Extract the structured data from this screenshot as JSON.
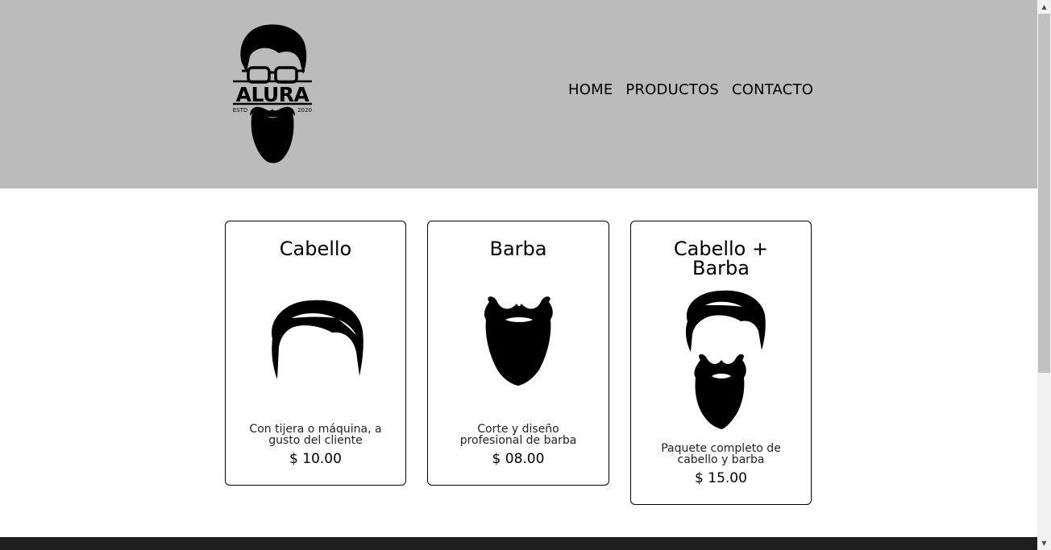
{
  "header": {
    "logo": {
      "brand": "ALURA",
      "est_left": "ESTD",
      "est_right": "2020"
    },
    "nav": [
      {
        "label": "HOME"
      },
      {
        "label": "PRODUCTOS"
      },
      {
        "label": "CONTACTO"
      }
    ]
  },
  "products": [
    {
      "title": "Cabello",
      "icon": "hair-icon",
      "description": "Con tijera o máquina, a gusto del cliente",
      "price": "$ 10.00"
    },
    {
      "title": "Barba",
      "icon": "beard-icon",
      "description": "Corte y diseño profesional de barba",
      "price": "$ 08.00"
    },
    {
      "title": "Cabello + Barba",
      "icon": "hair-and-beard-icon",
      "description": "Paquete completo de cabello y barba",
      "price": "$ 15.00"
    }
  ],
  "scrollbar": {
    "up_glyph": "▲",
    "down_glyph": "▼"
  },
  "colors": {
    "header_bg": "#bbbbbb",
    "footer_bg": "#1e1e1e",
    "text": "#000000"
  }
}
